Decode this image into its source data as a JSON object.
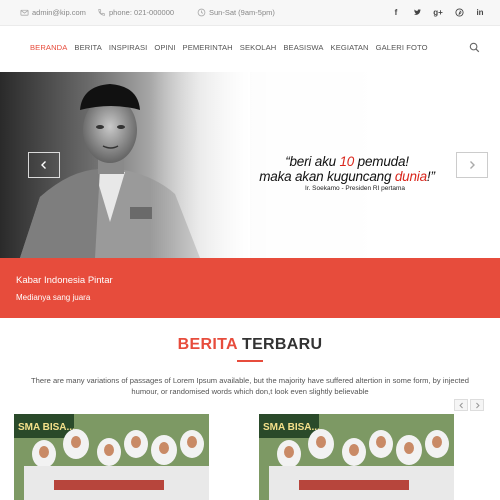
{
  "topbar": {
    "email": "admin@kip.com",
    "phone": "phone: 021-000000",
    "hours": "Sun-Sat (9am-5pm)",
    "social_icons": [
      "facebook-icon",
      "twitter-icon",
      "google-plus-icon",
      "pinterest-icon",
      "linkedin-icon"
    ]
  },
  "nav": {
    "items": [
      "BERANDA",
      "BERITA",
      "INSPIRASI",
      "OPINI",
      "PEMERINTAH",
      "SEKOLAH",
      "BEASISWA",
      "KEGIATAN",
      "GALERI FOTO"
    ],
    "active_index": 0
  },
  "hero": {
    "quote_prefix": "“beri aku ",
    "quote_number": "10",
    "quote_mid": " pemuda!",
    "quote_line2_prefix": "maka akan kuguncang ",
    "quote_highlight": "dunia",
    "quote_line2_suffix": "!”",
    "author": "Ir. Soekamo - Presiden RI pertama"
  },
  "banner": {
    "title": "Kabar Indonesia Pintar",
    "subtitle": "Medianya sang juara"
  },
  "section": {
    "title_red": "BERITA",
    "title_dark": " TERBARU",
    "description": "There are many variations of passages of Lorem Ipsum available, but the majority have suffered altertion in some form, by injected humour, or randomised words which don,t look even slightly believable"
  },
  "thumbs": [
    {
      "caption": "SMA BISA..."
    },
    {
      "caption": "SMA BISA..."
    }
  ],
  "colors": {
    "accent": "#e74c3c",
    "quote_red": "#d9261c"
  }
}
